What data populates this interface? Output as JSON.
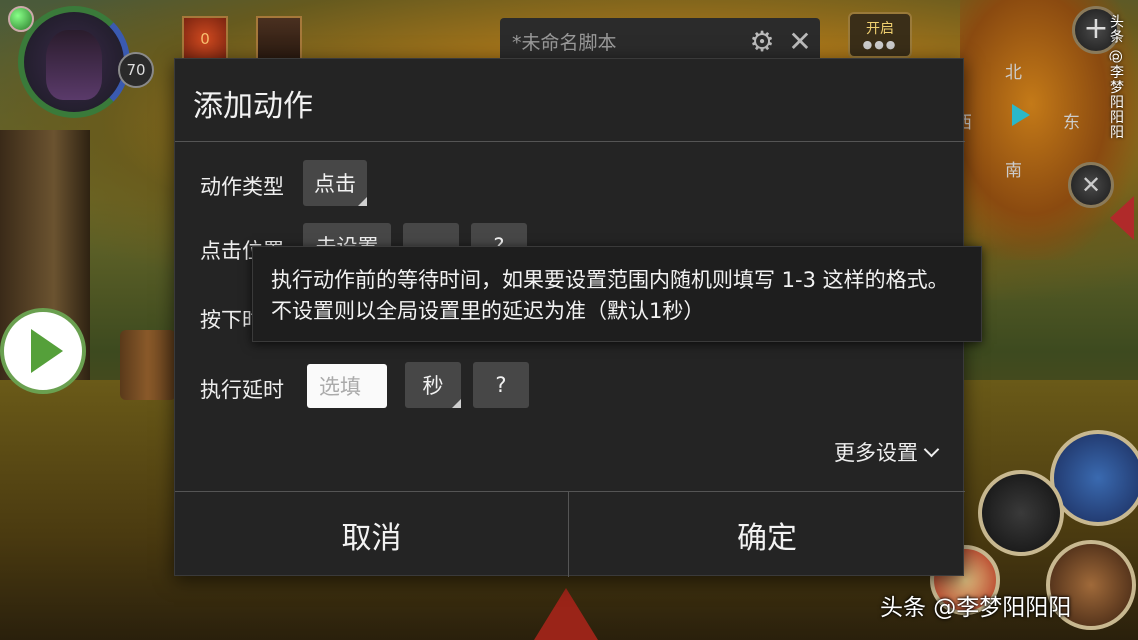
{
  "hud": {
    "level": "70",
    "gem_count": "0",
    "script_name": "*未命名脚本",
    "start_label": "开启",
    "start_dots": "●●●",
    "compass": {
      "north": "北",
      "west": "西",
      "east": "东",
      "south": "南"
    },
    "watermark_vertical": "头条 @李梦阳阳阳"
  },
  "dialog": {
    "title": "添加动作",
    "rows": {
      "action_type": {
        "label": "动作类型",
        "value": "点击"
      },
      "click_position": {
        "label": "点击位置",
        "value": "未设置",
        "extra": "",
        "help": "?"
      },
      "press": {
        "label": "按下时"
      },
      "delay": {
        "label": "执行延时",
        "placeholder": "选填",
        "unit": "秒",
        "help": "?"
      }
    },
    "more_settings": "更多设置",
    "cancel": "取消",
    "confirm": "确定"
  },
  "tooltip": {
    "text": "执行动作前的等待时间，如果要设置范围内随机则填写 1-3 这样的格式。不设置则以全局设置里的延迟为准（默认1秒）"
  },
  "watermark": "头条 @李梦阳阳阳"
}
